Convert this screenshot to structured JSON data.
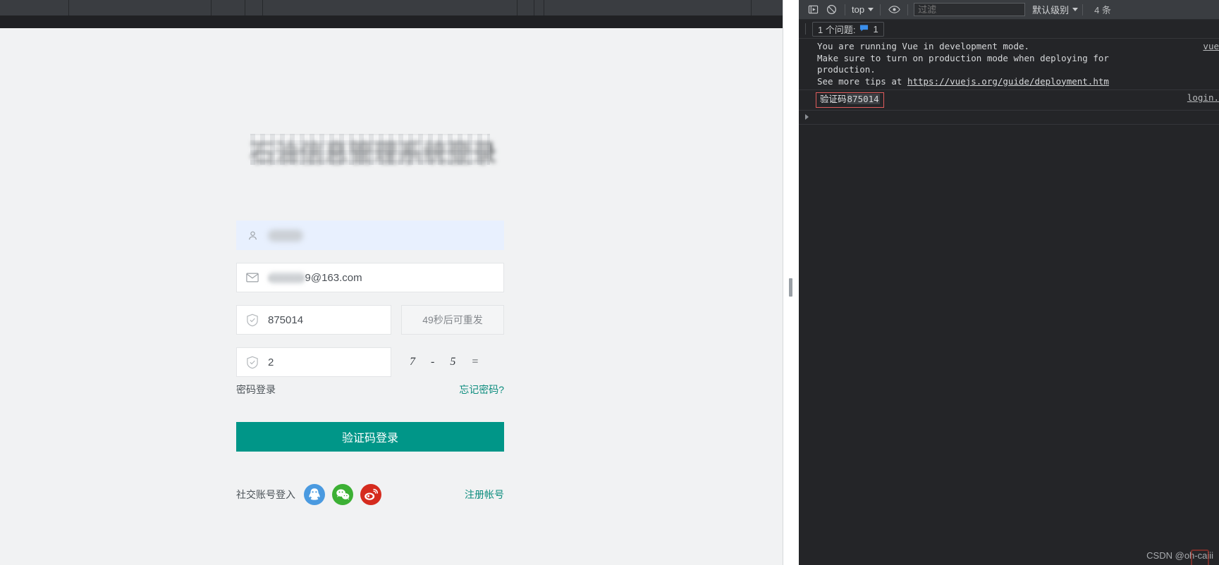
{
  "page": {
    "title_text": "石油信息管理系统登录",
    "form": {
      "username": {
        "value": "",
        "icon": "user-icon",
        "state": "autofilled-blurred"
      },
      "email": {
        "blurred_prefix": "xxxxxxx",
        "visible_value": "9@163.com",
        "icon": "envelope-icon"
      },
      "code": {
        "value": "875014",
        "icon": "shield-check-icon"
      },
      "resend_label": "49秒后可重发",
      "captcha_answer": {
        "value": "2",
        "icon": "shield-check-icon"
      },
      "captcha_question": {
        "operand_a": "7",
        "operator": "-",
        "operand_b": "5",
        "equals": "="
      },
      "password_login_link": "密码登录",
      "forgot_password_link": "忘记密码?",
      "submit_label": "验证码登录",
      "social_label": "社交账号登入",
      "social_icons": [
        {
          "name": "qq-icon",
          "color": "#4a9ae0"
        },
        {
          "name": "wechat-icon",
          "color": "#3cb034"
        },
        {
          "name": "weibo-icon",
          "color": "#d52b1e"
        }
      ],
      "register_link": "注册帐号"
    },
    "accent_color": "#009688",
    "link_color": "#0b8c7d"
  },
  "devtools": {
    "toolbar": {
      "execute_icon": "execute-snippet-icon",
      "clear_icon": "clear-console-icon",
      "context_label": "top",
      "eye_icon": "live-expression-eye-icon",
      "filter_placeholder": "过滤",
      "filter_value": "",
      "level_label": "默认级别",
      "hidden_count": "4 条"
    },
    "issues": {
      "label": "1 个问题:",
      "badge_icon": "issue-message-icon",
      "count": "1"
    },
    "log": [
      {
        "type": "warning",
        "lines": [
          "You are running Vue in development mode.",
          "Make sure to turn on production mode when deploying for",
          "production.",
          "See more tips at "
        ],
        "link_text": "https://vuejs.org/guide/deployment.htm",
        "source": "vue"
      },
      {
        "type": "log",
        "boxed": true,
        "label_cn": "验证码",
        "value": "875014",
        "source": "login."
      },
      {
        "type": "expandable",
        "arrow": "expand-arrow-icon"
      }
    ]
  },
  "watermark": "CSDN @oh-caiii"
}
